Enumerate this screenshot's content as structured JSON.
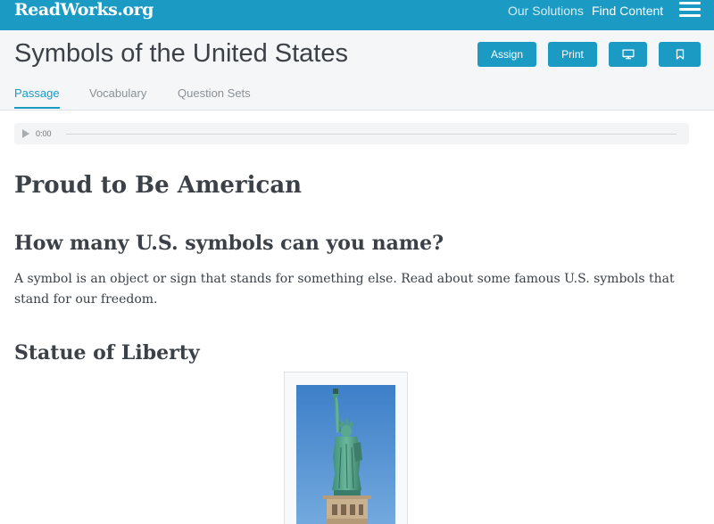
{
  "topbar": {
    "logo": "ReadWorks.org",
    "nav": {
      "solutions": "Our Solutions",
      "find_content": "Find Content"
    },
    "menu_icon": "hamburger-menu-icon"
  },
  "header": {
    "title": "Symbols of the United States",
    "buttons": {
      "assign": "Assign",
      "print": "Print",
      "present_icon": "monitor-icon",
      "bookmark_icon": "bookmark-icon"
    },
    "tabs": [
      {
        "label": "Passage",
        "active": true
      },
      {
        "label": "Vocabulary",
        "active": false
      },
      {
        "label": "Question Sets",
        "active": false
      }
    ]
  },
  "audio": {
    "time": "0:00",
    "play_icon": "play-icon"
  },
  "article": {
    "heading": "Proud to Be American",
    "subheading": "How many U.S. symbols can you name?",
    "intro": "A symbol is an object or sign that stands for something else. Read about some famous U.S. symbols that stand for our freedom.",
    "section_heading": "Statue of Liberty"
  },
  "colors": {
    "brand": "#1b9ac4",
    "header_bg": "#f4f6f7",
    "text": "#3b4147",
    "muted": "#8a9197"
  }
}
